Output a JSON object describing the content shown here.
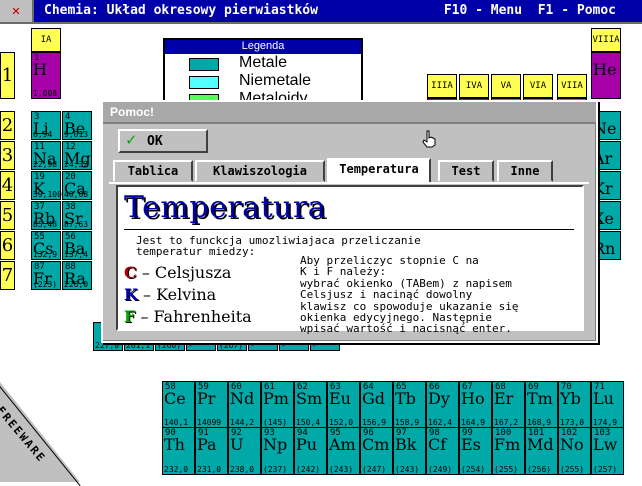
{
  "window": {
    "title": "Chemia: Układ okresowy pierwiastków",
    "menu_hint": "F10 - Menu  F1 - Pomoc",
    "system_menu_icon": "x-icon"
  },
  "colors": {
    "metal": "#00a8a8",
    "nonmetal": "#a800a8",
    "noble": "#ffff54",
    "titlebar": "#0000a8"
  },
  "periodic_table": {
    "group_labels": [
      "IA",
      "IIIA",
      "IVA",
      "VA",
      "VIA",
      "VIIA",
      "VIIIA"
    ],
    "periods": [
      "1",
      "2",
      "3",
      "4",
      "5",
      "6",
      "7"
    ],
    "elements": [
      {
        "num": "1",
        "sym": "H",
        "mass": "1,008"
      },
      {
        "num": "3",
        "sym": "Li",
        "mass": "6,94"
      },
      {
        "num": "4",
        "sym": "Be",
        "mass": "9,013"
      },
      {
        "num": "11",
        "sym": "Na",
        "mass": "22,98"
      },
      {
        "num": "12",
        "sym": "Mg",
        "mass": "24,32"
      },
      {
        "num": "19",
        "sym": "K",
        "mass": "39,100"
      },
      {
        "num": "20",
        "sym": "Ca",
        "mass": "40,08"
      },
      {
        "num": "37",
        "sym": "Rb",
        "mass": "85,48"
      },
      {
        "num": "38",
        "sym": "Sr",
        "mass": "87,63"
      },
      {
        "num": "55",
        "sym": "Cs",
        "mass": "132,9"
      },
      {
        "num": "56",
        "sym": "Ba",
        "mass": "137,4"
      },
      {
        "num": "87",
        "sym": "Fr",
        "mass": "(223)"
      },
      {
        "num": "88",
        "sym": "Ra",
        "mass": "226,0"
      },
      {
        "num": "",
        "sym": "",
        "mass": "227,0"
      },
      {
        "num": "",
        "sym": "",
        "mass": "261,1"
      },
      {
        "num": "",
        "sym": "",
        "mass": "(260)"
      },
      {
        "num": "",
        "sym": "",
        "mass": "-"
      },
      {
        "num": "",
        "sym": "",
        "mass": "(267)"
      },
      {
        "num": "",
        "sym": "",
        "mass": "-"
      },
      {
        "num": "",
        "sym": "",
        "mass": "-"
      },
      {
        "num": "",
        "sym": "",
        "mass": "-"
      },
      {
        "num": "",
        "sym": "He",
        "mass": ""
      },
      {
        "num": "",
        "sym": "Ne",
        "mass": ""
      },
      {
        "num": "",
        "sym": "Ar",
        "mass": ""
      },
      {
        "num": "",
        "sym": "Kr",
        "mass": ""
      },
      {
        "num": "",
        "sym": "Xe",
        "mass": ""
      },
      {
        "num": "",
        "sym": "Rn",
        "mass": ""
      }
    ],
    "lanthanides": [
      {
        "num": "58",
        "sym": "Ce",
        "mass": "140,1"
      },
      {
        "num": "59",
        "sym": "Pr",
        "mass": "14099"
      },
      {
        "num": "60",
        "sym": "Nd",
        "mass": "144,2"
      },
      {
        "num": "61",
        "sym": "Pm",
        "mass": "(145)"
      },
      {
        "num": "62",
        "sym": "Sm",
        "mass": "150,4"
      },
      {
        "num": "63",
        "sym": "Eu",
        "mass": "152,0"
      },
      {
        "num": "64",
        "sym": "Gd",
        "mass": "156,9"
      },
      {
        "num": "65",
        "sym": "Tb",
        "mass": "158,9"
      },
      {
        "num": "66",
        "sym": "Dy",
        "mass": "162,4"
      },
      {
        "num": "67",
        "sym": "Ho",
        "mass": "164,9"
      },
      {
        "num": "68",
        "sym": "Er",
        "mass": "167,2"
      },
      {
        "num": "69",
        "sym": "Tm",
        "mass": "168,9"
      },
      {
        "num": "70",
        "sym": "Yb",
        "mass": "173,0"
      },
      {
        "num": "71",
        "sym": "Lu",
        "mass": "174,9"
      }
    ],
    "actinides": [
      {
        "num": "90",
        "sym": "Th",
        "mass": "232,0"
      },
      {
        "num": "91",
        "sym": "Pa",
        "mass": "231,0"
      },
      {
        "num": "92",
        "sym": "U",
        "mass": "238,0"
      },
      {
        "num": "93",
        "sym": "Np",
        "mass": "(237)"
      },
      {
        "num": "94",
        "sym": "Pu",
        "mass": "(242)"
      },
      {
        "num": "95",
        "sym": "Am",
        "mass": "(243)"
      },
      {
        "num": "96",
        "sym": "Cm",
        "mass": "(247)"
      },
      {
        "num": "97",
        "sym": "Bk",
        "mass": "(243)"
      },
      {
        "num": "98",
        "sym": "Cf",
        "mass": "(249)"
      },
      {
        "num": "99",
        "sym": "Es",
        "mass": "(254)"
      },
      {
        "num": "100",
        "sym": "Fm",
        "mass": "(255)"
      },
      {
        "num": "101",
        "sym": "Md",
        "mass": "(256)"
      },
      {
        "num": "102",
        "sym": "No",
        "mass": "(255)"
      },
      {
        "num": "103",
        "sym": "Lw",
        "mass": "(257)"
      }
    ]
  },
  "legend": {
    "title": "Legenda",
    "items": [
      {
        "label": "Metale",
        "color": "#00a8a8"
      },
      {
        "label": "Niemetale",
        "color": "#54ffff"
      },
      {
        "label": "Metaloidy",
        "color": "#54ff54"
      }
    ]
  },
  "dialog": {
    "title": "Pomoc!",
    "ok_label": "OK",
    "tabs": [
      "Tablica",
      "Klawiszologia",
      "Temperatura",
      "Test",
      "Inne"
    ],
    "active_tab": "Temperatura",
    "heading": "Temperatura",
    "intro": "Jest to funckcja umozliwiajaca przeliczanie\ntemperatur miedzy:",
    "scales": [
      {
        "letter": "C",
        "rest": "– Celsjusza",
        "color": "#a80000"
      },
      {
        "letter": "K",
        "rest": "– Kelvina",
        "color": "#0000a8"
      },
      {
        "letter": "F",
        "rest": "– Fahrenheita",
        "color": "#00a800"
      }
    ],
    "instructions": "Aby przeliczyc stopnie C na\nK i F należy:\nwybrać okienko (TABem) z napisem\nCelsjusz i nacinąć dowolny\nklawisz co spowoduje ukazanie się\nokienka edycyjnego. Następnie\nwpisać wartość i nacisnąć enter."
  },
  "watermark": "FREEWARE"
}
